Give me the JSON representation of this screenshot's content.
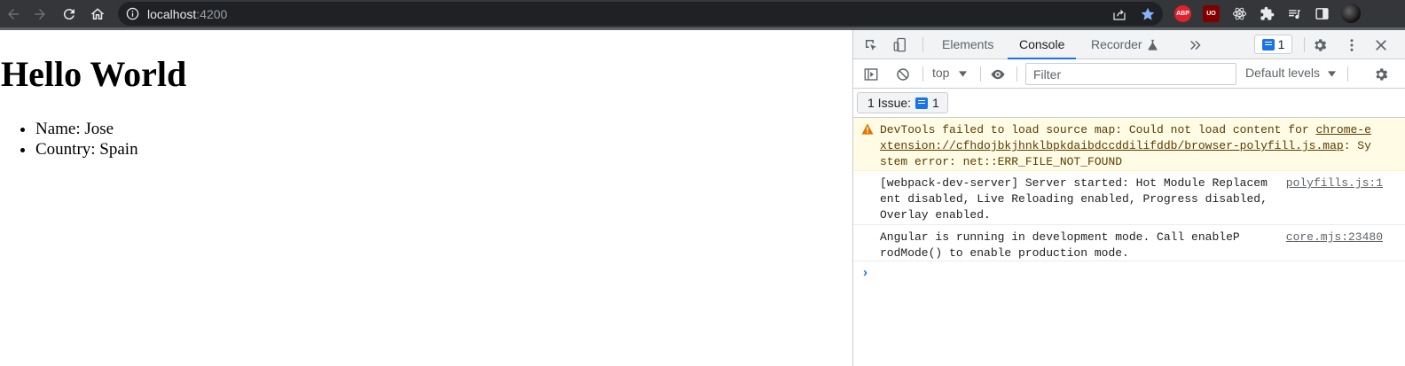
{
  "browser": {
    "url_host": "localhost",
    "url_port": ":4200",
    "extensions": {
      "abp_label": "ABP",
      "ublock_label": "UO"
    },
    "colors": {
      "star": "#8ab4f8",
      "toolbar": "#35363a"
    }
  },
  "page": {
    "heading": "Hello World",
    "items": [
      "Name: Jose",
      "Country: Spain"
    ]
  },
  "devtools": {
    "tabs": [
      "Elements",
      "Console",
      "Recorder"
    ],
    "active_tab": "Console",
    "issues_badge_count": "1",
    "context_select": "top",
    "filter_placeholder": "Filter",
    "levels_label": "Default levels",
    "issues_bar_label": "1 Issue:",
    "issues_bar_count": "1",
    "messages": [
      {
        "type": "warning",
        "text_prefix": "DevTools failed to load source map: Could not load content for ",
        "link": "chrome-extension://cfhdojbkjhnklbpkdaibdccddilifddb/browser-polyfill.js.map",
        "text_suffix": ": System error: net::ERR_FILE_NOT_FOUND"
      },
      {
        "type": "info",
        "text": "[webpack-dev-server] Server started: Hot Module Replacement disabled, Live Reloading enabled, Progress disabled, Overlay enabled.",
        "source": "polyfills.js:1"
      },
      {
        "type": "info",
        "text": "Angular is running in development mode. Call enableProdMode() to enable production mode.",
        "source": "core.mjs:23480"
      }
    ],
    "prompt": "›"
  }
}
